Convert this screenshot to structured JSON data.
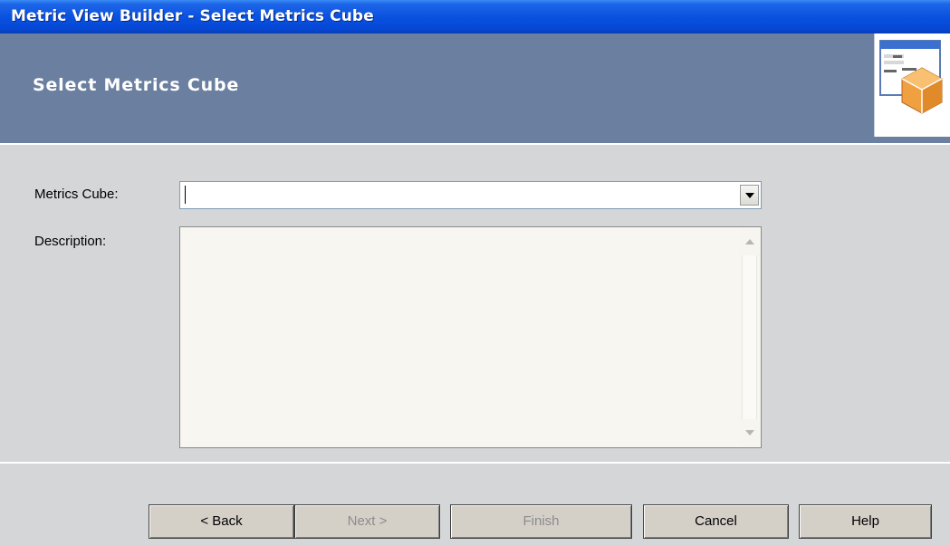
{
  "window": {
    "title": "Metric View Builder - Select Metrics Cube"
  },
  "header": {
    "title": "Select Metrics Cube",
    "icon": "cube-window-icon"
  },
  "form": {
    "metrics_cube_label": "Metrics Cube:",
    "metrics_cube_value": "",
    "description_label": "Description:",
    "description_value": ""
  },
  "buttons": {
    "back": "< Back",
    "next": "Next >",
    "finish": "Finish",
    "cancel": "Cancel",
    "help": "Help"
  },
  "colors": {
    "titlebar": "#0a52e0",
    "header_bg": "#6b80a0",
    "panel_bg": "#d4d6d8",
    "cube_orange": "#f0a040"
  }
}
